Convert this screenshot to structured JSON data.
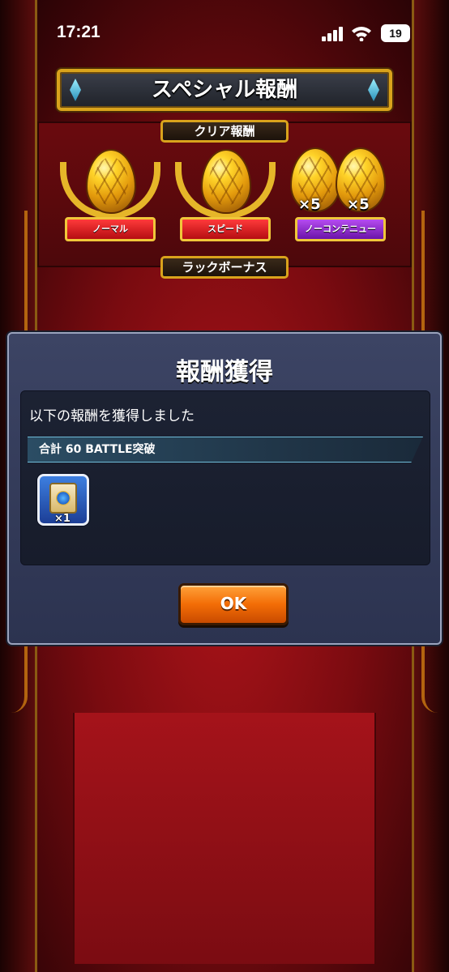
{
  "status_bar": {
    "time": "17:21",
    "battery": "19"
  },
  "title": "スペシャル報酬",
  "sections": {
    "clear_reward": "クリア報酬",
    "luck_bonus": "ラックボーナス"
  },
  "rewards": [
    {
      "label": "ノーマル",
      "multiplier": ""
    },
    {
      "label": "スピード",
      "multiplier": ""
    },
    {
      "label": "ノーコンテニュー",
      "multiplier": "×5"
    }
  ],
  "extra_multiplier": "×5",
  "modal": {
    "title": "報酬獲得",
    "message": "以下の報酬を獲得しました",
    "battle_text": "合計 60 BATTLE突破",
    "item_count": "×1",
    "ok_label": "OK"
  },
  "colors": {
    "background": "#9c1017",
    "gold": "#d9a31c",
    "modal": "#343b5a",
    "ok_button": "#f36d06"
  },
  "icons": [
    "signal-icon",
    "wifi-icon",
    "egg-icon",
    "scroll-item-icon"
  ]
}
